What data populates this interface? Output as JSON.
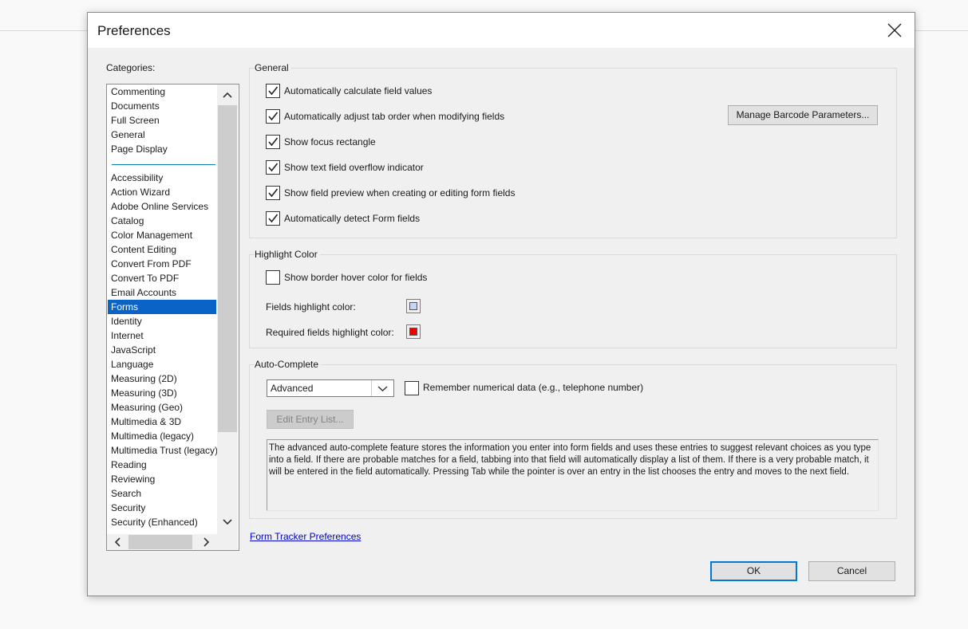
{
  "dialog": {
    "title": "Preferences"
  },
  "categories": {
    "label": "Categories:",
    "top_items": [
      "Commenting",
      "Documents",
      "Full Screen",
      "General",
      "Page Display"
    ],
    "items": [
      "Accessibility",
      "Action Wizard",
      "Adobe Online Services",
      "Catalog",
      "Color Management",
      "Content Editing",
      "Convert From PDF",
      "Convert To PDF",
      "Email Accounts",
      "Forms",
      "Identity",
      "Internet",
      "JavaScript",
      "Language",
      "Measuring (2D)",
      "Measuring (3D)",
      "Measuring (Geo)",
      "Multimedia & 3D",
      "Multimedia (legacy)",
      "Multimedia Trust (legacy)",
      "Reading",
      "Reviewing",
      "Search",
      "Security",
      "Security (Enhanced)"
    ],
    "selected": "Forms"
  },
  "general": {
    "legend": "General",
    "options": [
      {
        "label": "Automatically calculate field values",
        "checked": true
      },
      {
        "label": "Automatically adjust tab order when modifying fields",
        "checked": true
      },
      {
        "label": "Show focus rectangle",
        "checked": true
      },
      {
        "label": "Show text field overflow indicator",
        "checked": true
      },
      {
        "label": "Show field preview when creating or editing form fields",
        "checked": true
      },
      {
        "label": "Automatically detect Form fields",
        "checked": true
      }
    ],
    "manage_barcode_label": "Manage Barcode Parameters..."
  },
  "highlight": {
    "legend": "Highlight Color",
    "border_hover_label": "Show border hover color for fields",
    "border_hover_checked": false,
    "fields_color_label": "Fields highlight color:",
    "fields_color": "#c6d4f8",
    "required_color_label": "Required fields highlight color:",
    "required_color": "#ee0000"
  },
  "autocomplete": {
    "legend": "Auto-Complete",
    "mode": "Advanced",
    "remember_label": "Remember numerical data (e.g., telephone number)",
    "remember_checked": false,
    "edit_entry_label": "Edit Entry List...",
    "description": "The advanced auto-complete feature stores the information you enter into form fields and uses these entries to suggest relevant choices as you type into a field. If there are probable matches for a field, tabbing into that field will automatically display a list of them. If there is a very probable match, it will be entered in the field automatically. Pressing Tab while the pointer is over an entry in the list chooses the entry and moves to the next field."
  },
  "form_tracker_link": "Form Tracker Preferences",
  "buttons": {
    "ok": "OK",
    "cancel": "Cancel"
  },
  "colors": {
    "selection": "#0a64c8",
    "primary_border": "#0078d7",
    "link": "#0000cc"
  }
}
